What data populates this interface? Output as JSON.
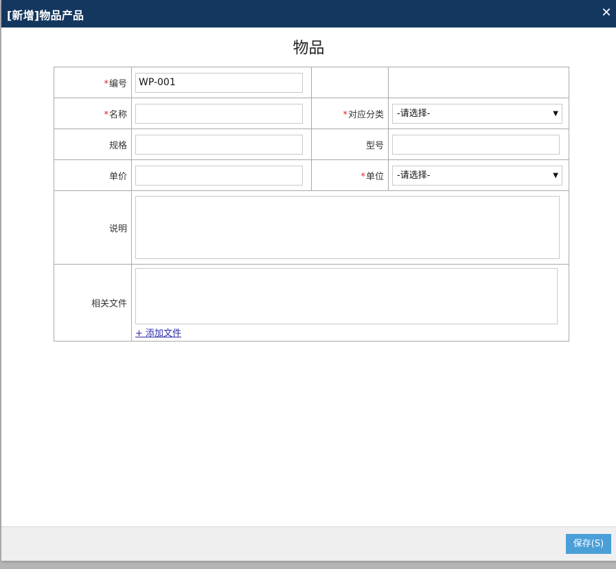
{
  "window": {
    "title": "[新增]物品产品",
    "close_glyph": "✕"
  },
  "form": {
    "title": "物品",
    "required_mark": "*",
    "code": {
      "label": "编号",
      "value": "WP-001"
    },
    "name": {
      "label": "名称",
      "value": ""
    },
    "category": {
      "label": "对应分类",
      "selected": "-请选择-"
    },
    "spec": {
      "label": "规格",
      "value": ""
    },
    "model": {
      "label": "型号",
      "value": ""
    },
    "price": {
      "label": "单价",
      "value": ""
    },
    "unit": {
      "label": "单位",
      "selected": "-请选择-"
    },
    "description": {
      "label": "说明",
      "value": ""
    },
    "files": {
      "label": "相关文件",
      "add_link": "+ 添加文件"
    }
  },
  "footer": {
    "save_label": "保存(S)"
  },
  "colors": {
    "titlebar_bg": "#14375f",
    "required": "#e02020",
    "save_button_bg": "#4a9fd8"
  }
}
